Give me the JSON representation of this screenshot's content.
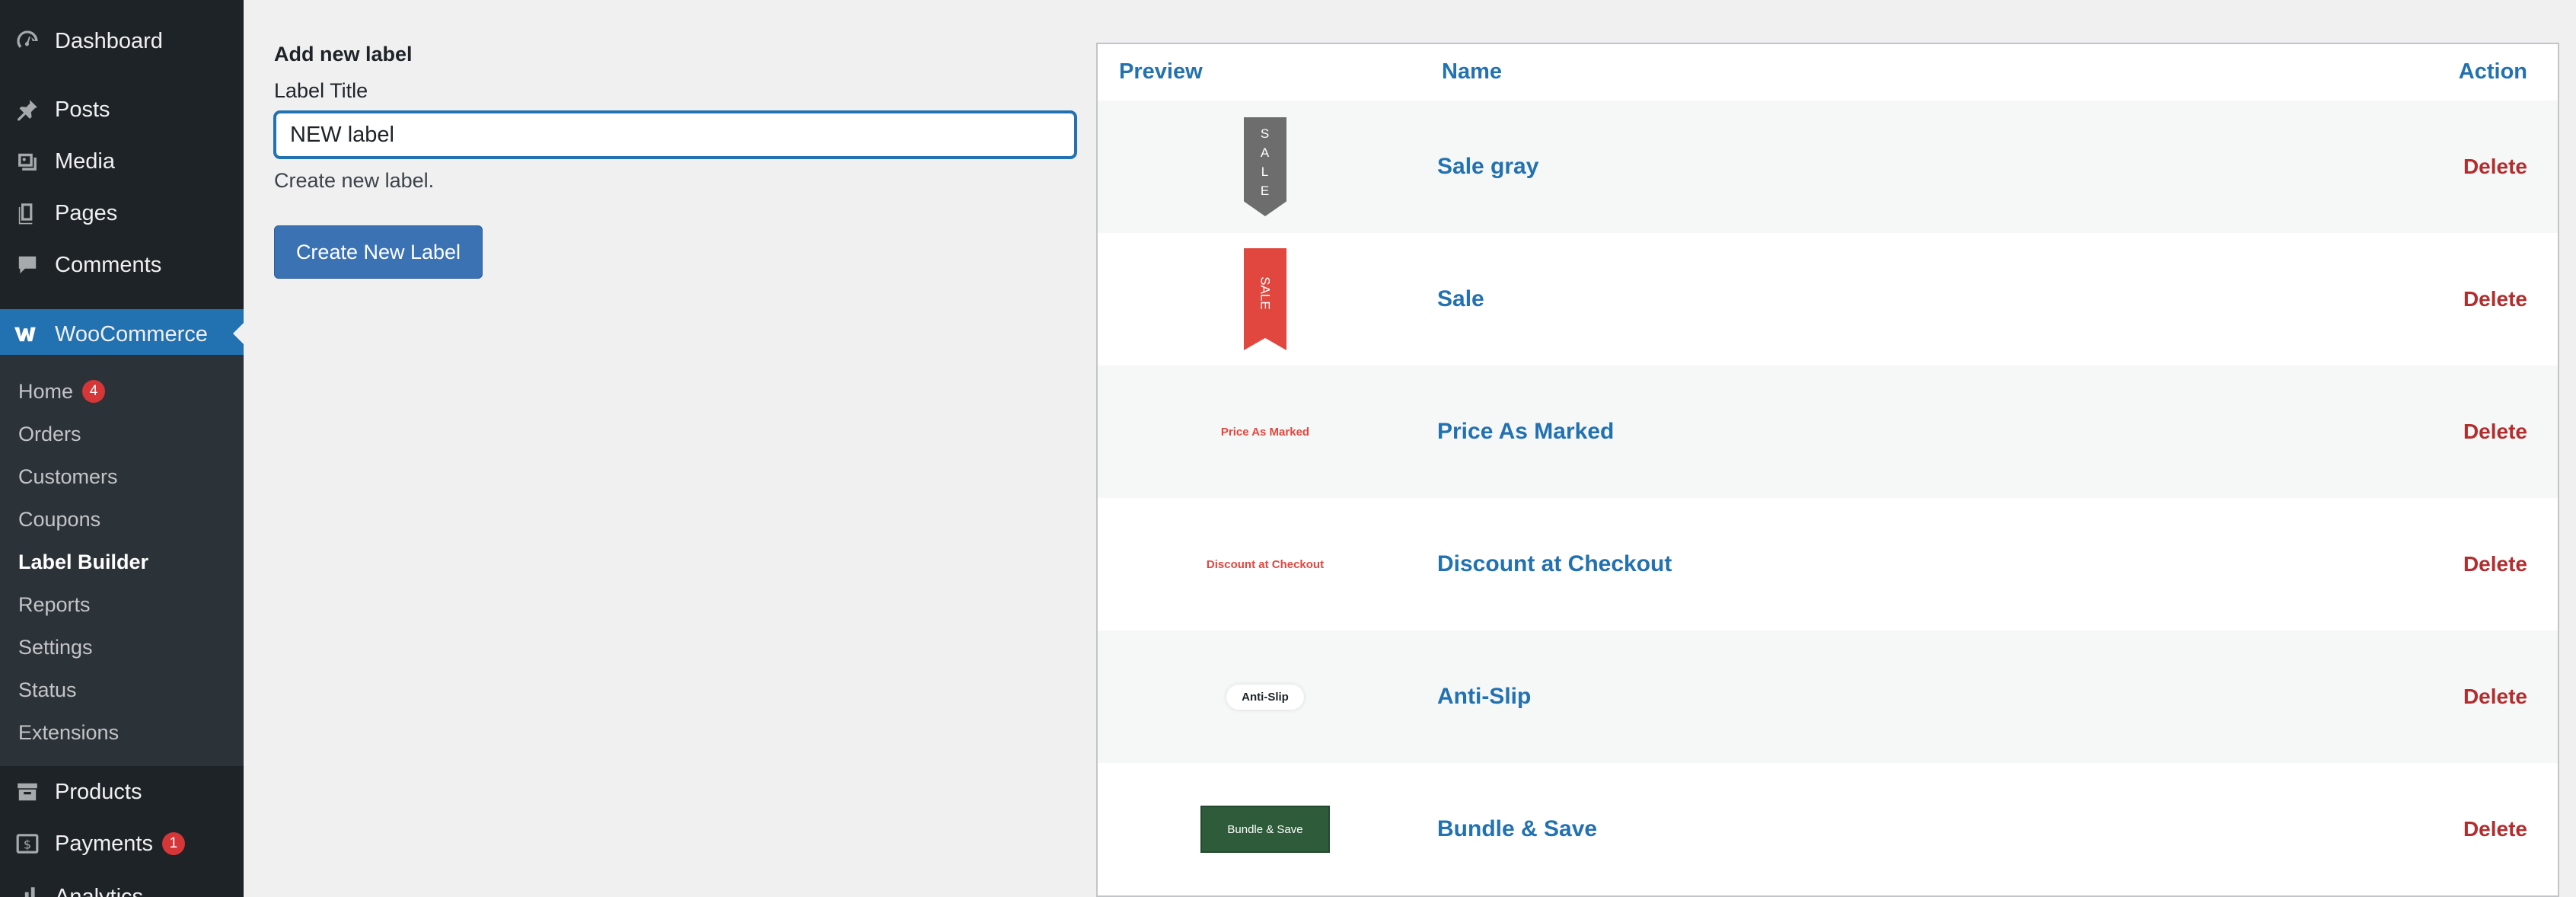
{
  "sidebar": {
    "dashboard": "Dashboard",
    "posts": "Posts",
    "media": "Media",
    "pages": "Pages",
    "comments": "Comments",
    "woocommerce": "WooCommerce",
    "submenu": {
      "home": "Home",
      "home_badge": "4",
      "orders": "Orders",
      "customers": "Customers",
      "coupons": "Coupons",
      "label_builder": "Label Builder",
      "reports": "Reports",
      "settings": "Settings",
      "status": "Status",
      "extensions": "Extensions"
    },
    "products": "Products",
    "payments": "Payments",
    "payments_badge": "1",
    "analytics": "Analytics",
    "icons": {
      "dashboard": "dashboard-icon",
      "posts": "pin-icon",
      "media": "media-icon",
      "pages": "pages-icon",
      "comments": "comment-icon",
      "woocommerce": "woocommerce-icon",
      "products": "archive-icon",
      "payments": "payments-icon",
      "analytics": "chart-icon"
    }
  },
  "form": {
    "heading": "Add new label",
    "field_label": "Label Title",
    "input_value": "NEW label",
    "description": "Create new label.",
    "button": "Create New Label"
  },
  "table": {
    "headers": {
      "preview": "Preview",
      "name": "Name",
      "action": "Action"
    },
    "rows": [
      {
        "name": "Sale gray",
        "preview_text": [
          "S",
          "A",
          "L",
          "E"
        ],
        "action": "Delete"
      },
      {
        "name": "Sale",
        "preview_text": "SALE",
        "action": "Delete"
      },
      {
        "name": "Price As Marked",
        "preview_text": "Price As Marked",
        "action": "Delete"
      },
      {
        "name": "Discount at Checkout",
        "preview_text": "Discount at Checkout",
        "action": "Delete"
      },
      {
        "name": "Anti-Slip",
        "preview_text": "Anti-Slip",
        "action": "Delete"
      },
      {
        "name": "Bundle & Save",
        "preview_text": "Bundle & Save",
        "action": "Delete"
      }
    ]
  },
  "colors": {
    "sidebar_bg": "#1d2327",
    "submenu_bg": "#2c3338",
    "accent": "#2271b1",
    "button": "#3a72b4",
    "delete": "#b32d2e",
    "badge": "#d63638",
    "label_gray": "#6d6d6d",
    "label_red": "#e2473f",
    "label_green": "#2e5b3a"
  }
}
